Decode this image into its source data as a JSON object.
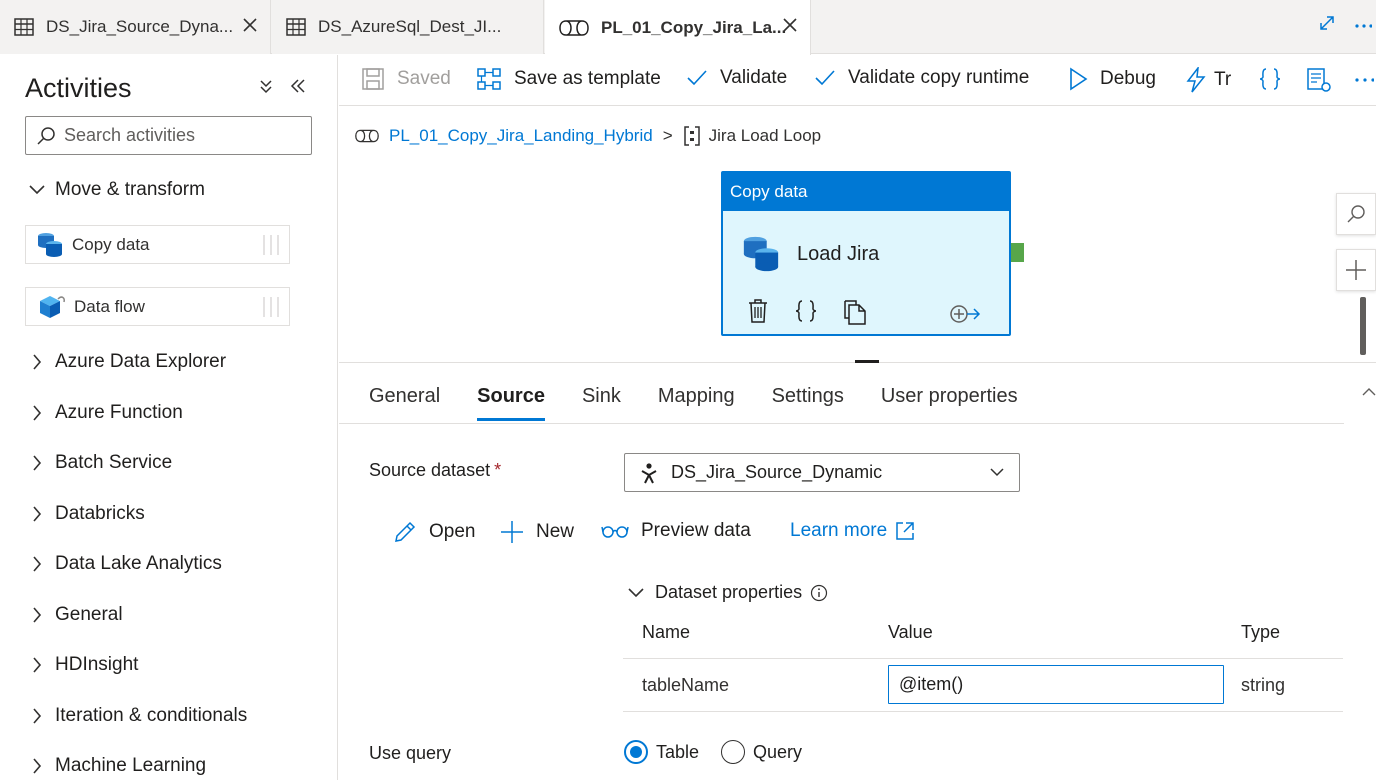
{
  "tabs": [
    {
      "label": "DS_Jira_Source_Dyna...",
      "icon": "table-icon"
    },
    {
      "label": "DS_AzureSql_Dest_JI...",
      "icon": "table-icon"
    },
    {
      "label": "PL_01_Copy_Jira_La...",
      "icon": "pipeline-icon",
      "active": true
    }
  ],
  "sidebar": {
    "title": "Activities",
    "search_placeholder": "Search activities",
    "groups": [
      {
        "label": "Move & transform",
        "expanded": true
      },
      {
        "label": "Azure Data Explorer"
      },
      {
        "label": "Azure Function"
      },
      {
        "label": "Batch Service"
      },
      {
        "label": "Databricks"
      },
      {
        "label": "Data Lake Analytics"
      },
      {
        "label": "General"
      },
      {
        "label": "HDInsight"
      },
      {
        "label": "Iteration & conditionals"
      },
      {
        "label": "Machine Learning"
      }
    ],
    "activities": [
      {
        "label": "Copy data",
        "icon": "copy-data-icon"
      },
      {
        "label": "Data flow",
        "icon": "data-flow-icon"
      }
    ]
  },
  "toolbar": {
    "saved": "Saved",
    "save_template": "Save as template",
    "validate": "Validate",
    "validate_runtime": "Validate copy runtime",
    "debug": "Debug",
    "trigger": "Tr"
  },
  "canvas": {
    "breadcrumb_pipeline": "PL_01_Copy_Jira_Landing_Hybrid",
    "breadcrumb_sep": ">",
    "breadcrumb_current": "Jira Load Loop",
    "node_header": "Copy data",
    "node_name": "Load Jira"
  },
  "props": {
    "tabs": [
      "General",
      "Source",
      "Sink",
      "Mapping",
      "Settings",
      "User properties"
    ],
    "active_tab": "Source",
    "source_dataset_label": "Source dataset",
    "required_mark": "*",
    "source_dataset_value": "DS_Jira_Source_Dynamic",
    "actions": {
      "open": "Open",
      "new": "New",
      "preview": "Preview data",
      "learn_more": "Learn more"
    },
    "dataset_properties": {
      "title": "Dataset properties",
      "columns": [
        "Name",
        "Value",
        "Type"
      ],
      "row": {
        "name": "tableName",
        "value": "@item()",
        "type": "string"
      }
    },
    "use_query": {
      "label": "Use query",
      "options": [
        "Table",
        "Query"
      ],
      "selected": "Table"
    }
  },
  "colors": {
    "accent": "#0078d4",
    "node_fill": "#dff6fd",
    "port_green": "#57a64a"
  }
}
